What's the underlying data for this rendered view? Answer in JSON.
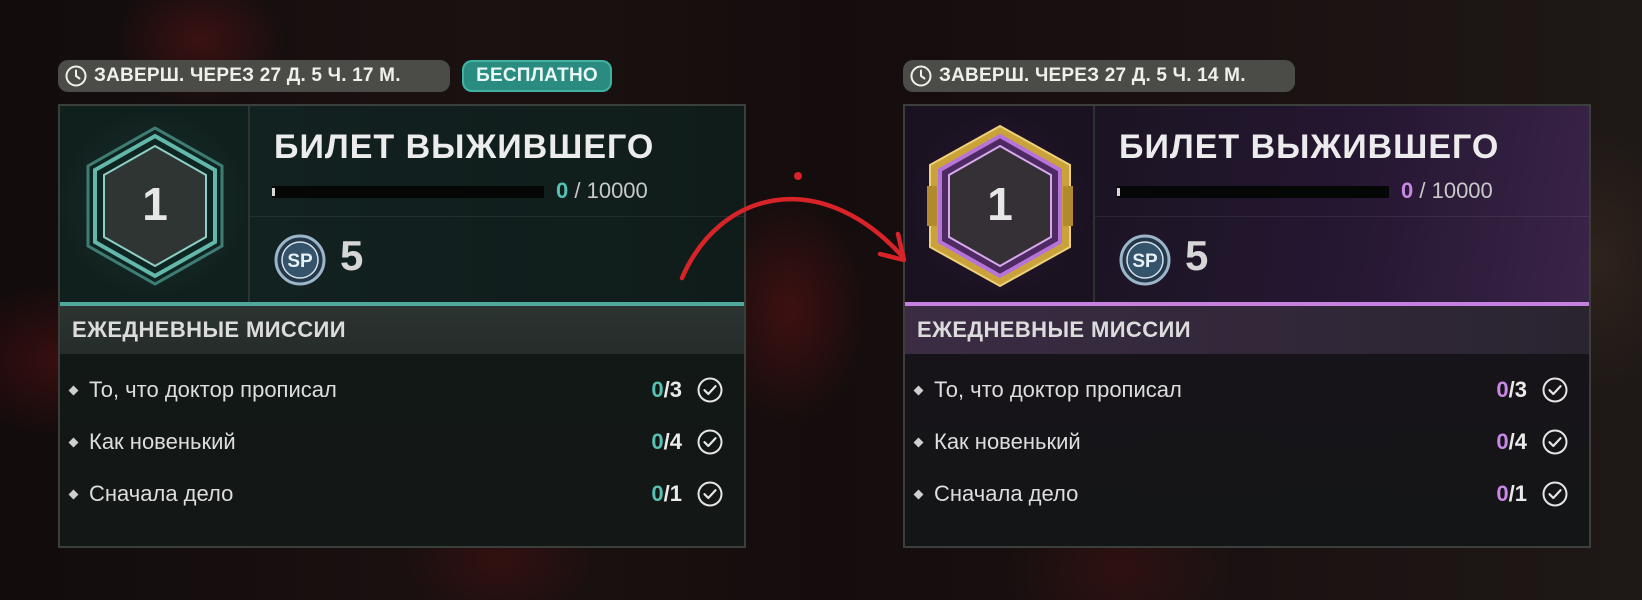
{
  "panels": [
    {
      "timer_text": "ЗАВЕРШ. ЧЕРЕЗ 27 Д. 5 Ч. 17 М.",
      "badge_label": "БЕСПЛАТНО",
      "rank": "1",
      "title": "БИЛЕТ ВЫЖИВШЕГО",
      "progress_current": "0",
      "progress_total": "/ 10000",
      "progress_fraction": 0,
      "sp_label": "SP",
      "sp_value": "5",
      "section_title": "ЕЖЕДНЕВНЫЕ МИССИИ",
      "accent_color": "#4ea89c",
      "missions": [
        {
          "name": "То, что доктор прописал",
          "current": "0",
          "total": "/3"
        },
        {
          "name": "Как новенький",
          "current": "0",
          "total": "/4"
        },
        {
          "name": "Сначала дело",
          "current": "0",
          "total": "/1"
        }
      ]
    },
    {
      "timer_text": "ЗАВЕРШ. ЧЕРЕЗ 27 Д. 5 Ч. 14 М.",
      "rank": "1",
      "title": "БИЛЕТ ВЫЖИВШЕГО",
      "progress_current": "0",
      "progress_total": "/ 10000",
      "progress_fraction": 0,
      "sp_label": "SP",
      "sp_value": "5",
      "section_title": "ЕЖЕДНЕВНЫЕ МИССИИ",
      "accent_color": "#c580e0",
      "missions": [
        {
          "name": "То, что доктор прописал",
          "current": "0",
          "total": "/3"
        },
        {
          "name": "Как новенький",
          "current": "0",
          "total": "/4"
        },
        {
          "name": "Сначала дело",
          "current": "0",
          "total": "/1"
        }
      ]
    }
  ],
  "icons": {
    "timer": "clock-icon",
    "sp": "sp-icon",
    "mission_status": "check-circle-icon",
    "transition": "curved-arrow-icon"
  },
  "colors": {
    "free_accent": "#4ea89c",
    "premium_accent": "#c580e0",
    "annotation_red": "#d82328",
    "premium_frame_gold": "#c9a23a"
  }
}
